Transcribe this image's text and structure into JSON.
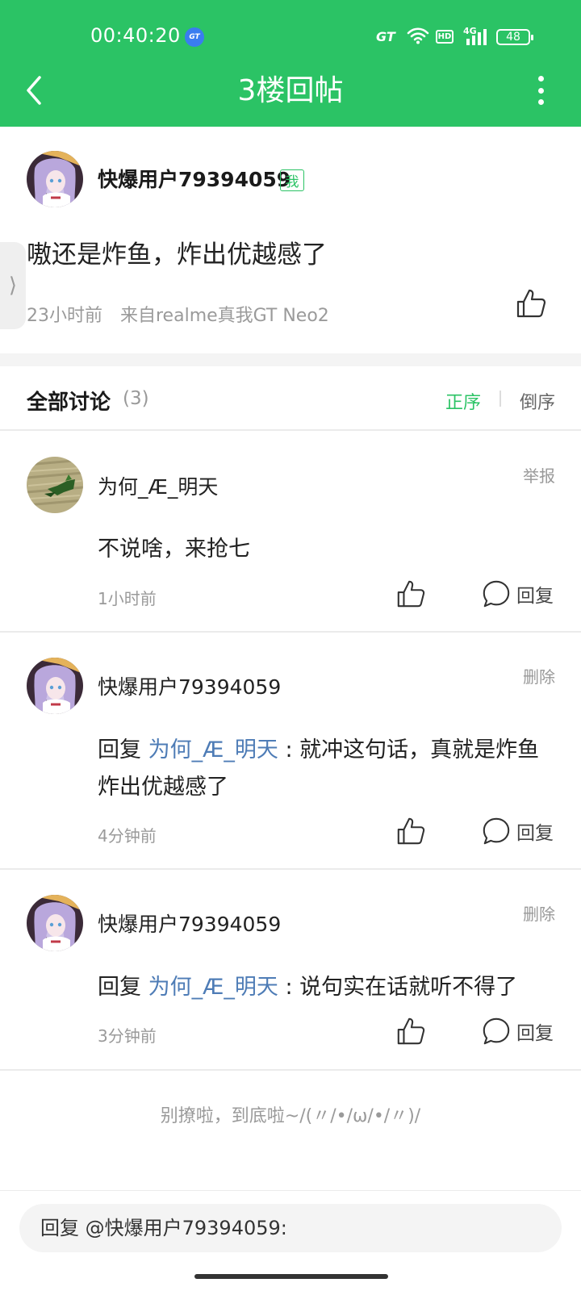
{
  "status_bar": {
    "time": "00:40:20",
    "gt_icon_label": "GT",
    "gt_label": "GT",
    "hd_label": "HD",
    "network_label": "4G",
    "battery": "48"
  },
  "header": {
    "title": "3楼回帖"
  },
  "post": {
    "author": "快爆用户79394059",
    "me_badge": "我",
    "content": "嗷还是炸鱼，炸出优越感了",
    "time": "23小时前",
    "source": "来自realme真我GT Neo2"
  },
  "side_tab": "⟩",
  "discussion": {
    "title": "全部讨论",
    "count": "(3)",
    "sort_asc": "正序",
    "sort_desc": "倒序"
  },
  "comments": [
    {
      "author": "为何_Æ_明天",
      "action": "举报",
      "text": "不说啥，来抢七",
      "time": "1小时前",
      "reply_label": "回复"
    },
    {
      "author": "快爆用户79394059",
      "action": "删除",
      "reply_prefix": "回复 ",
      "reply_to": "为何_Æ_明天",
      "text": " : 就冲这句话，真就是炸鱼炸出优越感了",
      "time": "4分钟前",
      "reply_label": "回复"
    },
    {
      "author": "快爆用户79394059",
      "action": "删除",
      "reply_prefix": "回复 ",
      "reply_to": "为何_Æ_明天",
      "text": " : 说句实在话就听不得了",
      "time": "3分钟前",
      "reply_label": "回复"
    }
  ],
  "bottom_message": "别撩啦，到底啦~/(〃/•/ω/•/〃)/",
  "input": {
    "placeholder": "回复 @快爆用户79394059:"
  },
  "colors": {
    "accent": "#2bc365",
    "link": "#4e7cb6"
  }
}
